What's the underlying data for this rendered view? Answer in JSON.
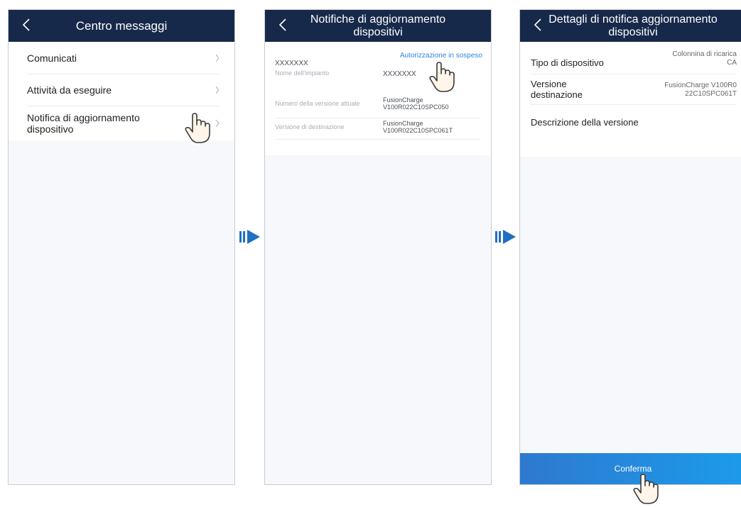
{
  "screen1": {
    "title": "Centro messaggi",
    "items": [
      {
        "label": "Comunicati"
      },
      {
        "label": "Attività da eseguire"
      },
      {
        "label": "Notifica di aggiornamento dispositivo"
      }
    ]
  },
  "screen2": {
    "title": "Notifiche di aggiornamento dispositivi",
    "device_name": "XXXXXXX",
    "status_link": "Autorizzazione in sospeso",
    "rows": [
      {
        "label": "Nome dell'impianto",
        "value": "XXXXXXX"
      },
      {
        "label": "Numero della versione attuale",
        "value_line1": "FusionCharge",
        "value_line2": "V100R022C10SPC050"
      },
      {
        "label": "Versione di destinazione",
        "value_line1": "FusionCharge",
        "value_line2": "V100R022C10SPC061T"
      }
    ]
  },
  "screen3": {
    "title": "Dettagli di notifica aggiornamento dispositivi",
    "device_type_label": "Tipo di dispositivo",
    "device_type_value_line1": "Colonnina di ricarica",
    "device_type_value_line2": "CA",
    "target_version_label_line1": "Versione",
    "target_version_label_line2": "destinazione",
    "target_version_value_line1": "FusionCharge V100R0",
    "target_version_value_line2": "22C10SPC061T",
    "description_label": "Descrizione della versione",
    "confirm_label": "Conferma"
  },
  "colors": {
    "titlebar": "#17294a",
    "link": "#2f86d8",
    "confirm_button": "#2e79cf",
    "arrow": "#1f6fc2"
  },
  "icons": [
    "back-chevron-icon",
    "chevron-right-icon",
    "hand-pointer-icon",
    "flow-arrow-icon"
  ]
}
